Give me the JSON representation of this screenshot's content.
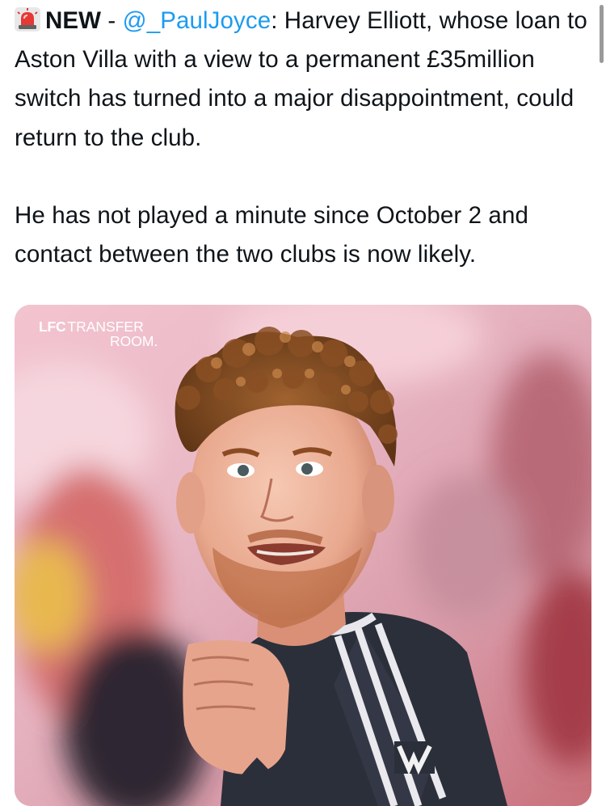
{
  "tweet": {
    "siren_icon": "siren-emoji-icon",
    "label": "NEW",
    "dash": " - ",
    "mention": "@_PaulJoyce",
    "line1_rest": ": Harvey Elliott, whose loan to Aston Villa with a view to a permanent £35million switch has turned into a major disappointment, could return to the club.",
    "paragraph2": "He has not played a minute since October 2 and contact between the two clubs is now likely."
  },
  "media": {
    "watermark_bold": "LFC",
    "watermark_light": "TRANSFER",
    "watermark_line2": "ROOM."
  },
  "colors": {
    "mention": "#1d9bf0",
    "text": "#0f1419",
    "background": "#ffffff"
  }
}
